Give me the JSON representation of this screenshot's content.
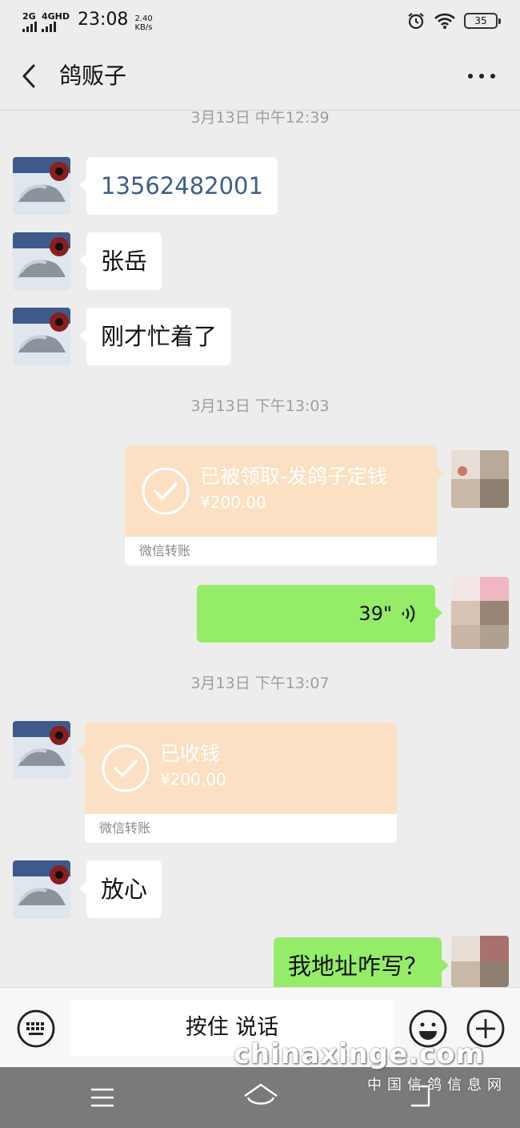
{
  "status": {
    "signal1": "2G",
    "signal2": "4GHD",
    "time": "23:08",
    "speed_value": "2.40",
    "speed_unit": "KB/s",
    "battery": "35"
  },
  "header": {
    "title": "鸽贩子"
  },
  "messages": {
    "ts1": "3月13日 中午12:39",
    "m1": "13562482001",
    "m2": "张岳",
    "m3": "刚才忙着了",
    "ts2": "3月13日 下午13:03",
    "t1_title": "已被领取-发鸽子定钱",
    "t1_amount": "¥200.00",
    "t1_label": "微信转账",
    "voice": "39\"",
    "ts3": "3月13日 下午13:07",
    "t2_title": "已收钱",
    "t2_amount": "¥200.00",
    "t2_label": "微信转账",
    "m4": "放心",
    "m5": "我地址咋写？"
  },
  "input": {
    "hold_to_talk": "按住 说话"
  },
  "watermark": {
    "domain": "chinaxinge.com",
    "name": "中国信鸽信息网"
  },
  "icons": {
    "back": "chevron-left-icon",
    "more": "more-dots-icon",
    "keyboard": "keyboard-icon",
    "emoji": "emoji-icon",
    "plus": "plus-icon",
    "voice": "voice-wave-icon",
    "check": "check-circle-icon"
  },
  "colors": {
    "background": "#ededed",
    "bubble_sent": "#95ec69",
    "transfer": "#fbe0c3",
    "phone_link": "#3e5e89"
  }
}
